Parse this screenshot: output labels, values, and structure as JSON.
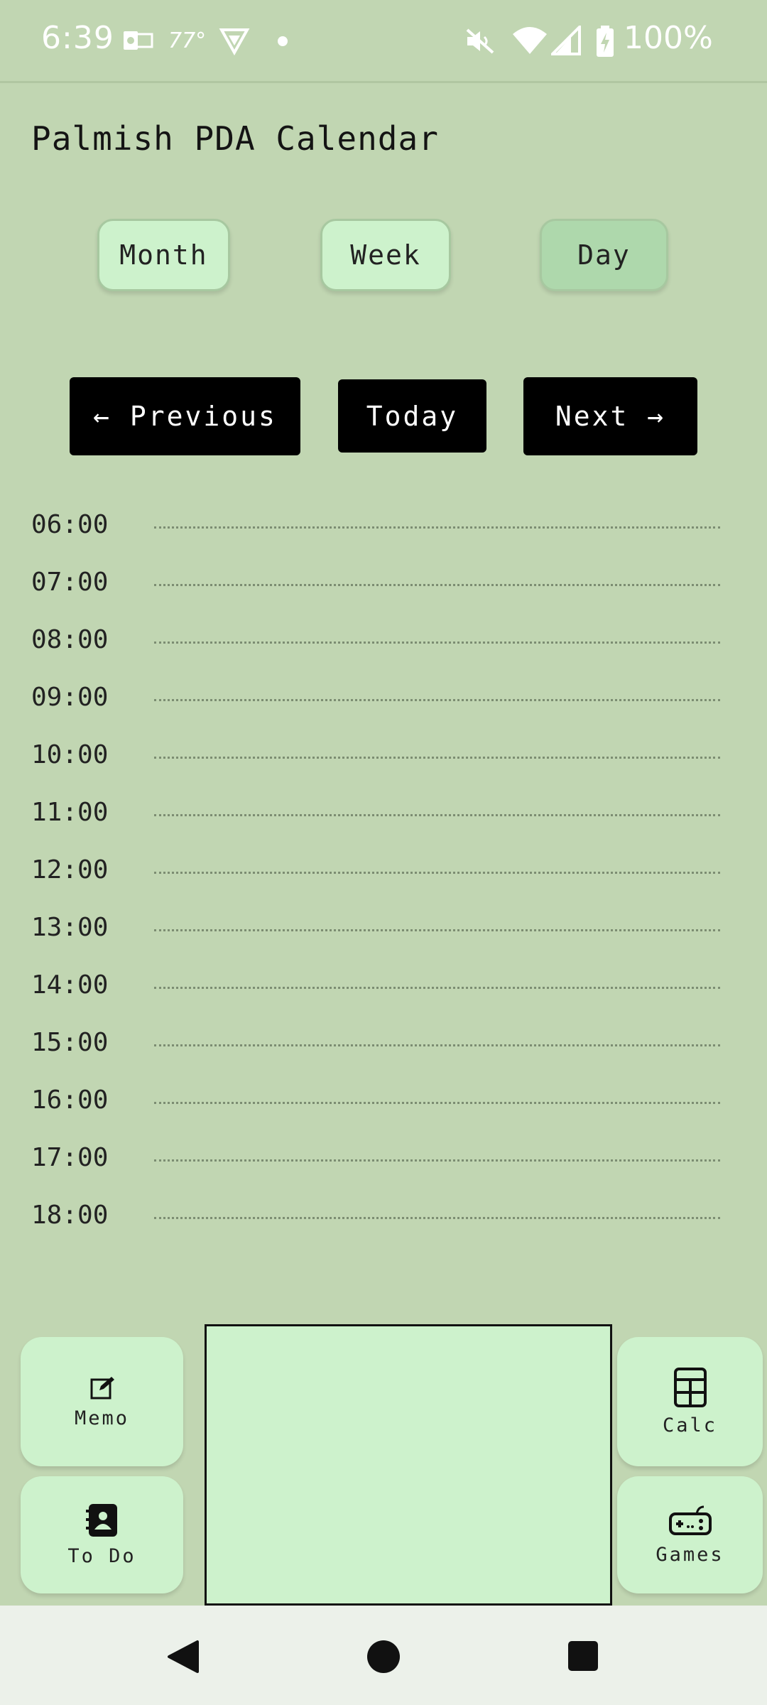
{
  "status_bar": {
    "time": "6:39",
    "temperature": "77°",
    "battery": "100%",
    "icons": [
      "outlook-icon",
      "vpn-shield-icon",
      "dot-icon",
      "mute-icon",
      "wifi-icon",
      "signal-icon",
      "battery-charging-icon"
    ]
  },
  "app": {
    "title": "Palmish PDA Calendar"
  },
  "view_tabs": [
    {
      "label": "Month",
      "active": false
    },
    {
      "label": "Week",
      "active": false
    },
    {
      "label": "Day",
      "active": true
    }
  ],
  "navigation": {
    "previous": "← Previous",
    "today": "Today",
    "next": "Next →"
  },
  "hours": [
    "06:00",
    "07:00",
    "08:00",
    "09:00",
    "10:00",
    "11:00",
    "12:00",
    "13:00",
    "14:00",
    "15:00",
    "16:00",
    "17:00",
    "18:00"
  ],
  "dock": {
    "memo": "Memo",
    "todo": "To Do",
    "calc": "Calc",
    "games": "Games"
  },
  "colors": {
    "background": "#c1d6b2",
    "button_bg": "#cdf2cc",
    "active_tab": "#aed8ac",
    "nav_button": "#000000"
  }
}
